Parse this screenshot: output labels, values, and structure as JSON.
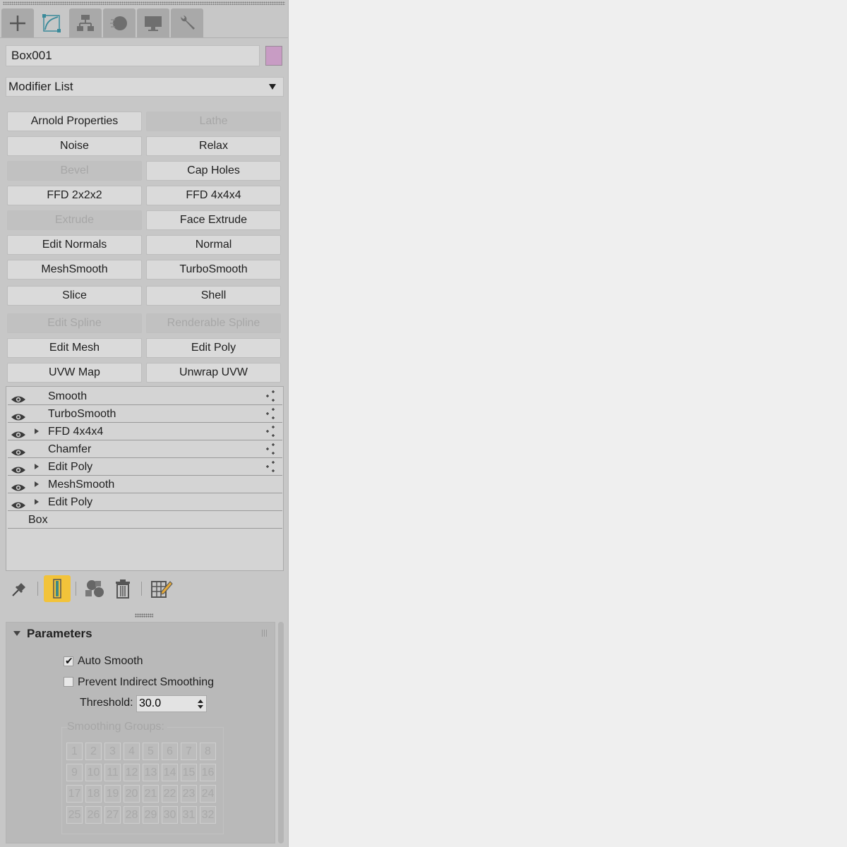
{
  "tabs": [
    {
      "icon": "create-icon",
      "active": false
    },
    {
      "icon": "modify-icon",
      "active": true
    },
    {
      "icon": "hierarchy-icon",
      "active": false
    },
    {
      "icon": "motion-icon",
      "active": false
    },
    {
      "icon": "display-icon",
      "active": false
    },
    {
      "icon": "utilities-icon",
      "active": false
    }
  ],
  "object": {
    "name": "Box001",
    "color": "#c89cc4"
  },
  "modifier_list": {
    "label": "Modifier List"
  },
  "modifier_buttons": [
    {
      "label": "Arnold Properties",
      "enabled": true
    },
    {
      "label": "Lathe",
      "enabled": false
    },
    {
      "label": "Noise",
      "enabled": true
    },
    {
      "label": "Relax",
      "enabled": true
    },
    {
      "label": "Bevel",
      "enabled": false
    },
    {
      "label": "Cap Holes",
      "enabled": true
    },
    {
      "label": "FFD 2x2x2",
      "enabled": true
    },
    {
      "label": "FFD 4x4x4",
      "enabled": true
    },
    {
      "label": "Extrude",
      "enabled": false
    },
    {
      "label": "Face Extrude",
      "enabled": true
    },
    {
      "label": "Edit Normals",
      "enabled": true
    },
    {
      "label": "Normal",
      "enabled": true
    },
    {
      "label": "MeshSmooth",
      "enabled": true
    },
    {
      "label": "TurboSmooth",
      "enabled": true
    },
    {
      "label": "Slice",
      "enabled": true
    },
    {
      "label": "Shell",
      "enabled": true
    },
    {
      "label": "Edit Spline",
      "enabled": false
    },
    {
      "label": "Renderable Spline",
      "enabled": false
    },
    {
      "label": "Edit Mesh",
      "enabled": true
    },
    {
      "label": "Edit Poly",
      "enabled": true
    },
    {
      "label": "UVW Map",
      "enabled": true
    },
    {
      "label": "Unwrap UVW",
      "enabled": true
    }
  ],
  "stack": [
    {
      "label": "Smooth",
      "eye": true,
      "expand": false,
      "gizmo": true
    },
    {
      "label": "TurboSmooth",
      "eye": true,
      "expand": false,
      "gizmo": true
    },
    {
      "label": "FFD 4x4x4",
      "eye": true,
      "expand": true,
      "gizmo": true
    },
    {
      "label": "Chamfer",
      "eye": true,
      "expand": false,
      "gizmo": true
    },
    {
      "label": "Edit Poly",
      "eye": true,
      "expand": true,
      "gizmo": true
    },
    {
      "label": "MeshSmooth",
      "eye": true,
      "expand": true,
      "gizmo": false
    },
    {
      "label": "Edit Poly",
      "eye": true,
      "expand": true,
      "gizmo": false
    },
    {
      "label": "Box",
      "eye": false,
      "expand": false,
      "gizmo": false
    }
  ],
  "stack_toolbar": [
    {
      "icon": "pin-stack-icon",
      "active": false
    },
    {
      "icon": "show-end-result-icon",
      "active": true
    },
    {
      "icon": "make-unique-icon",
      "active": false
    },
    {
      "icon": "remove-modifier-icon",
      "active": false
    },
    {
      "icon": "configure-modifier-sets-icon",
      "active": false
    }
  ],
  "parameters": {
    "title": "Parameters",
    "auto_smooth": {
      "label": "Auto Smooth",
      "checked": true
    },
    "prevent_indirect": {
      "label": "Prevent Indirect Smoothing",
      "checked": false
    },
    "threshold": {
      "label": "Threshold:",
      "value": "30.0"
    },
    "smoothing_groups": {
      "label": "Smoothing Groups:",
      "buttons": [
        "1",
        "2",
        "3",
        "4",
        "5",
        "6",
        "7",
        "8",
        "9",
        "10",
        "11",
        "12",
        "13",
        "14",
        "15",
        "16",
        "17",
        "18",
        "19",
        "20",
        "21",
        "22",
        "23",
        "24",
        "25",
        "26",
        "27",
        "28",
        "29",
        "30",
        "31",
        "32"
      ]
    }
  }
}
